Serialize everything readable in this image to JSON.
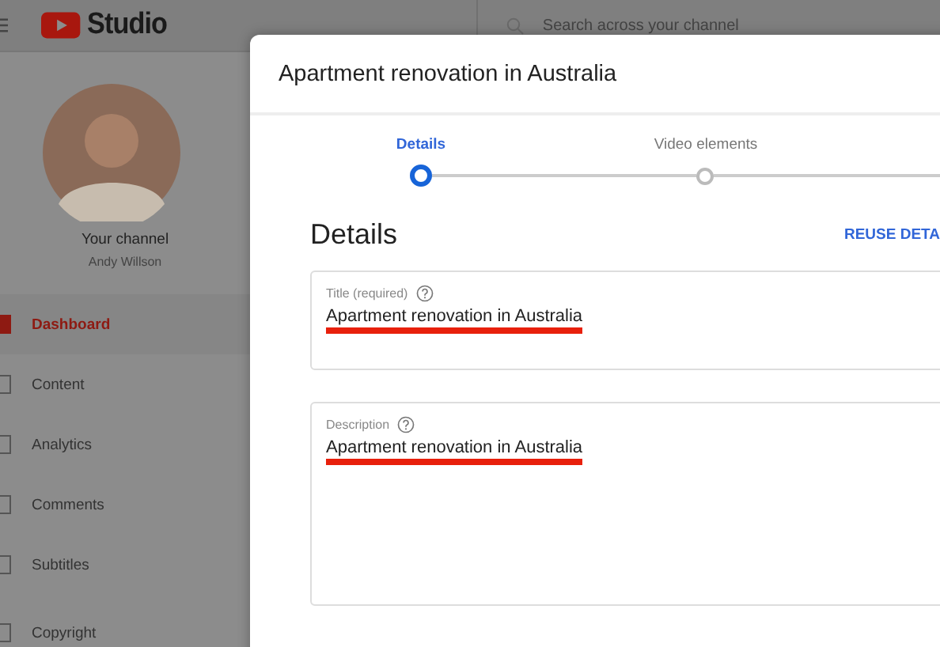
{
  "topbar": {
    "logo_text": "Studio",
    "search": {
      "placeholder": "Search across your channel"
    }
  },
  "channel": {
    "label": "Your channel",
    "name": "Andy Willson"
  },
  "sidebar": {
    "items": [
      {
        "label": "Dashboard",
        "selected": true
      },
      {
        "label": "Content",
        "selected": false
      },
      {
        "label": "Analytics",
        "selected": false
      },
      {
        "label": "Comments",
        "selected": false
      },
      {
        "label": "Subtitles",
        "selected": false
      },
      {
        "label": "Copyright",
        "selected": false
      }
    ]
  },
  "dialog": {
    "title": "Apartment renovation in Australia",
    "steps": [
      {
        "label": "Details",
        "selected": true
      },
      {
        "label": "Video elements",
        "selected": false
      }
    ],
    "heading": "Details",
    "reuse_button": "REUSE DETA",
    "fields": [
      {
        "kind": "single",
        "label": "Title (required)",
        "value": "Apartment renovation in Australia",
        "underlined": true
      },
      {
        "kind": "multi",
        "label": "Description",
        "value": "Apartment renovation in Australia",
        "underlined": true
      }
    ]
  }
}
